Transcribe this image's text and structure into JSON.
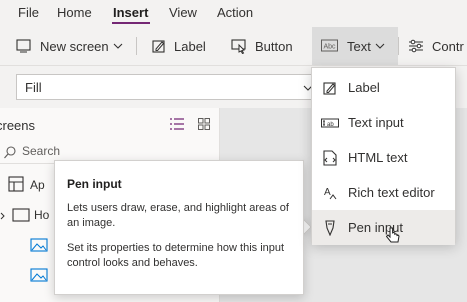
{
  "menubar": {
    "file": "File",
    "home": "Home",
    "insert": "Insert",
    "view": "View",
    "action": "Action"
  },
  "ribbon": {
    "new_screen": "New screen",
    "label": "Label",
    "button": "Button",
    "text": "Text",
    "controls": "Contr"
  },
  "formula": {
    "property": "Fill"
  },
  "left_panel": {
    "title": "creens",
    "search_placeholder": "Search",
    "app_label": "Ap",
    "home_label": "Ho"
  },
  "tooltip": {
    "title": "Pen input",
    "description": "Lets users draw, erase, and highlight areas of an image.",
    "hint": "Set its properties to determine how this input control looks and behaves."
  },
  "text_menu": {
    "items": [
      {
        "label": "Label",
        "icon": "label-icon"
      },
      {
        "label": "Text input",
        "icon": "text-input-icon"
      },
      {
        "label": "HTML text",
        "icon": "html-text-icon"
      },
      {
        "label": "Rich text editor",
        "icon": "rich-text-editor-icon"
      },
      {
        "label": "Pen input",
        "icon": "pen-input-icon"
      }
    ],
    "hovered_index": 4
  },
  "colors": {
    "accent": "#742774",
    "hover": "#edebe9"
  }
}
